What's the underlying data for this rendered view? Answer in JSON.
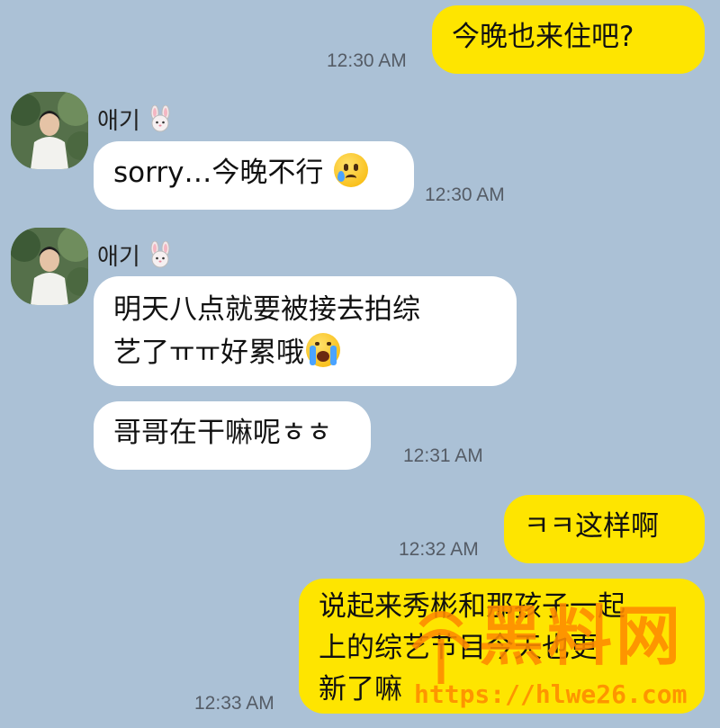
{
  "colors": {
    "background": "#abc1d6",
    "outgoing": "#fee500",
    "incoming": "#ffffff",
    "watermark": "#ff8a00"
  },
  "sender_name": "애기",
  "sender_badge_icon": "rabbit-face-icon",
  "messages": [
    {
      "text": "今晚也来住吧?",
      "time": "12:30 AM"
    },
    {
      "text": "sorry…今晚不行",
      "emoji": "tearful-smile-emoji",
      "time": "12:30 AM"
    },
    {
      "line1": "明天八点就要被接去拍综",
      "line2": "艺了ㅠㅠ好累哦",
      "emoji": "loudly-crying-emoji"
    },
    {
      "text": "哥哥在干嘛呢ㅎㅎ",
      "time": "12:31 AM"
    },
    {
      "text": "ㅋㅋ这样啊",
      "time": "12:32 AM"
    },
    {
      "line1": "说起来秀彬和那孩子一起",
      "line2": "上的综艺节目今天也更",
      "line3": "新了嘛",
      "time": "12:33 AM"
    }
  ],
  "watermark": {
    "logo_text": "黑料网",
    "url": "https://hlwe26.com"
  }
}
